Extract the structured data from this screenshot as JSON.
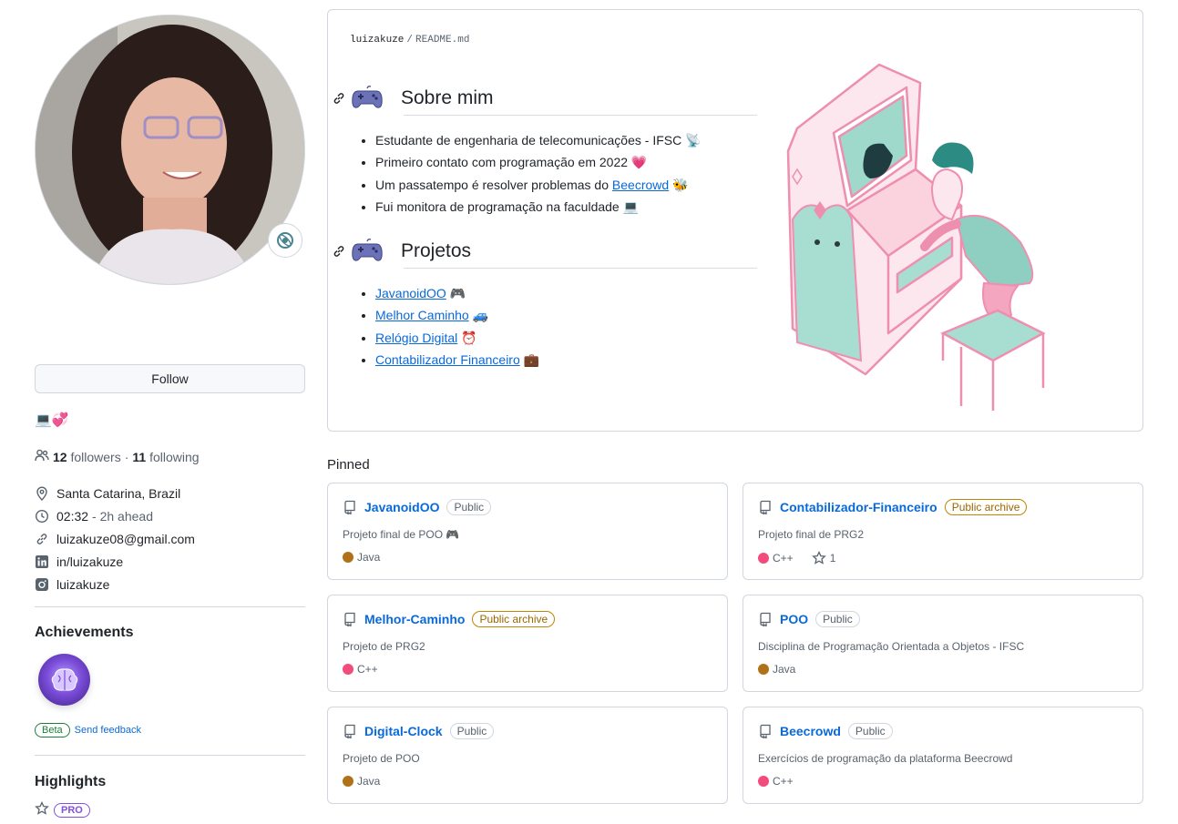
{
  "profile": {
    "follow_label": "Follow",
    "bio": "💻💞",
    "followers_count": "12",
    "followers_label": "followers",
    "separator": "·",
    "following_count": "11",
    "following_label": "following",
    "location": "Santa Catarina, Brazil",
    "local_time": "02:32",
    "time_offset": "- 2h ahead",
    "email": "luizakuze08@gmail.com",
    "linkedin": "in/luizakuze",
    "instagram": "luizakuze"
  },
  "achievements": {
    "title": "Achievements",
    "beta_label": "Beta",
    "feedback_label": "Send feedback"
  },
  "highlights": {
    "title": "Highlights",
    "pro_label": "PRO"
  },
  "readme": {
    "owner": "luizakuze",
    "separator": "/",
    "file": "README.md",
    "about_title": "Sobre mim",
    "about_items": [
      "Estudante de engenharia de telecomunicações - IFSC 📡",
      "Primeiro contato com programação em 2022 💗",
      "Um passatempo é resolver problemas do",
      "Fui monitora de programação na faculdade 💻"
    ],
    "beecrowd_link": "Beecrowd",
    "beecrowd_suffix": " 🐝",
    "projects_title": "Projetos",
    "projects": [
      {
        "label": "JavanoidOO",
        "emoji": " 🎮"
      },
      {
        "label": "Melhor Caminho",
        "emoji": " 🚙"
      },
      {
        "label": "Relógio Digital",
        "emoji": " ⏰"
      },
      {
        "label": "Contabilizador Financeiro",
        "emoji": " 💼"
      }
    ]
  },
  "pinned": {
    "title": "Pinned",
    "repos": [
      {
        "name": "JavanoidOO",
        "visibility": "Public",
        "description": "Projeto final de POO 🎮",
        "language": "Java",
        "language_color": "#b07219"
      },
      {
        "name": "Contabilizador-Financeiro",
        "visibility": "Public archive",
        "description": "Projeto final de PRG2",
        "language": "C++",
        "language_color": "#f34b7d",
        "stars": "1"
      },
      {
        "name": "Melhor-Caminho",
        "visibility": "Public archive",
        "description": "Projeto de PRG2",
        "language": "C++",
        "language_color": "#f34b7d"
      },
      {
        "name": "POO",
        "visibility": "Public",
        "description": "Disciplina de Programação Orientada a Objetos - IFSC",
        "language": "Java",
        "language_color": "#b07219"
      },
      {
        "name": "Digital-Clock",
        "visibility": "Public",
        "description": "Projeto de POO",
        "language": "Java",
        "language_color": "#b07219"
      },
      {
        "name": "Beecrowd",
        "visibility": "Public",
        "description": "Exercícios de programação da plataforma Beecrowd",
        "language": "C++",
        "language_color": "#f34b7d"
      }
    ]
  }
}
